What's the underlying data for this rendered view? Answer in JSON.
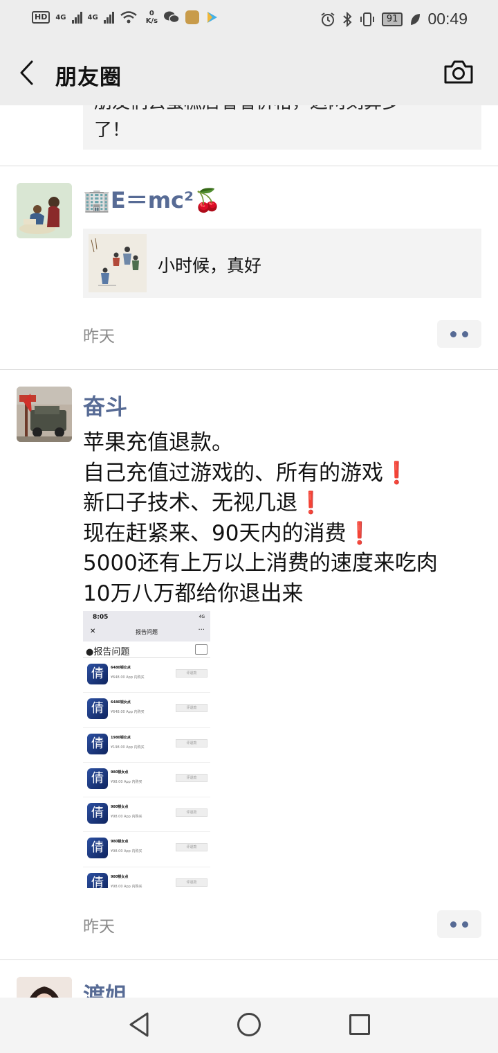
{
  "status_bar": {
    "hd": "HD",
    "net_a": "4G",
    "net_b": "4G",
    "speed_value": "0",
    "speed_unit": "K/s",
    "battery": "91",
    "time": "00:49"
  },
  "header": {
    "title": "朋友圈"
  },
  "top_quote": {
    "line1": "朋友们去蛋糕店看看价格，这两刻算多",
    "line2": "了！"
  },
  "posts": [
    {
      "nickname": "🏢E＝mc²🍒",
      "link_text": "小时候，真好",
      "time": "昨天"
    },
    {
      "nickname": "奋斗",
      "body": [
        "苹果充值退款。",
        "自己充值过游戏的、所有的游戏❗",
        "新口子技术、无视几退❗",
        "现在赶紧来、90天内的消费❗",
        "5000还有上万以上消费的速度来吃肉",
        "10万八万都给你退出来"
      ],
      "time": "昨天",
      "image": {
        "time": "8:05",
        "signal": "4G",
        "title": "报告问题",
        "close": "✕",
        "more": "···",
        "brand": "报告问题",
        "rows": [
          {
            "name": "6480银女点",
            "price": "¥648.00 App 内购买",
            "button": "评退款"
          },
          {
            "name": "6480银女点",
            "price": "¥648.00 App 内购买",
            "button": "评退款"
          },
          {
            "name": "1980银女点",
            "price": "¥198.00 App 内购买",
            "button": "评退款"
          },
          {
            "name": "980银女点",
            "price": "¥98.00 App 内购买",
            "button": "评退款"
          },
          {
            "name": "980银女点",
            "price": "¥98.00 App 内购买",
            "button": "评退款"
          },
          {
            "name": "980银女点",
            "price": "¥98.00 App 内购买",
            "button": "评退款"
          },
          {
            "name": "980银女点",
            "price": "¥98.00 App 内购买",
            "button": "评退款"
          }
        ]
      }
    },
    {
      "nickname": "渡姐"
    }
  ]
}
